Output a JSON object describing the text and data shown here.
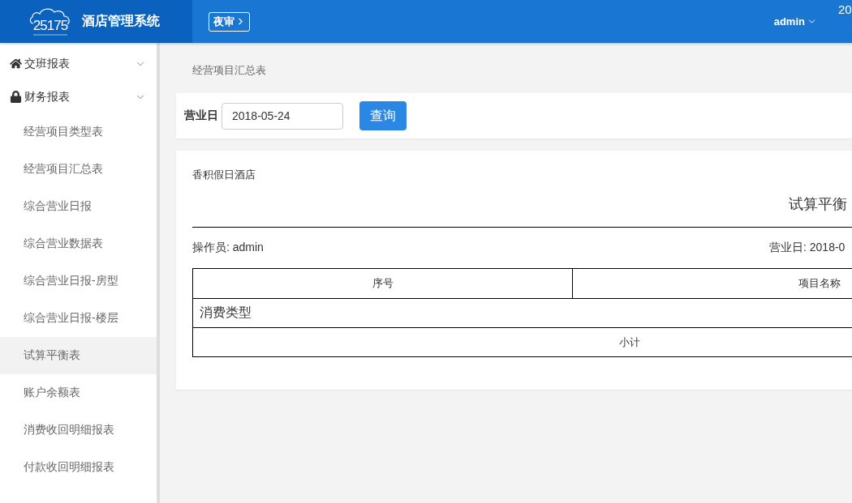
{
  "header": {
    "logo_text": "25175",
    "title": "酒店管理系统",
    "night_audit_button": "夜审",
    "user_menu": "admin",
    "corner_text": "20"
  },
  "sidebar": {
    "groups": [
      {
        "label": "交班报表"
      },
      {
        "label": "财务报表",
        "children": [
          {
            "label": "经营项目类型表",
            "selected": false
          },
          {
            "label": "经营项目汇总表",
            "selected": false
          },
          {
            "label": "综合营业日报",
            "selected": false
          },
          {
            "label": "综合营业数据表",
            "selected": false
          },
          {
            "label": "综合营业日报-房型",
            "selected": false
          },
          {
            "label": "综合营业日报-楼层",
            "selected": false
          },
          {
            "label": "试算平衡表",
            "selected": true
          },
          {
            "label": "账户余额表",
            "selected": false
          },
          {
            "label": "消费收回明细报表",
            "selected": false
          },
          {
            "label": "付款收回明细报表",
            "selected": false
          }
        ]
      }
    ]
  },
  "breadcrumb": "经营项目汇总表",
  "filter": {
    "label": "营业日",
    "value": "2018-05-24",
    "button": "查询"
  },
  "report": {
    "hotel": "香积假日酒店",
    "title": "试算平衡",
    "operator": "操作员: admin",
    "business_date": "营业日: 2018-0",
    "table": {
      "columns": [
        "序号",
        "项目名称"
      ],
      "rows": [
        {
          "kind": "group",
          "label": "消费类型"
        },
        {
          "kind": "subtotal",
          "label": "小计"
        }
      ]
    }
  }
}
